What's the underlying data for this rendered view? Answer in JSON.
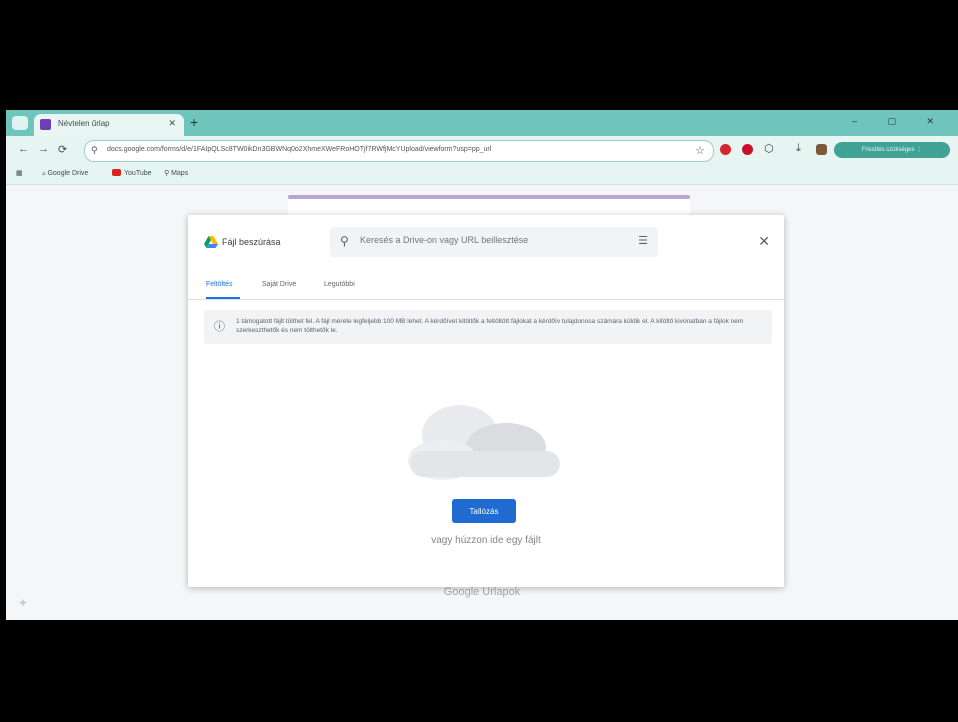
{
  "browser": {
    "tab_title": "Névtelen űrlap",
    "tab_close": "✕",
    "new_tab": "+",
    "window_controls": "– ▢ ✕",
    "nav": {
      "back": "←",
      "forward": "→",
      "reload": "⟳"
    },
    "url": "docs.google.com/forms/d/e/1FAIpQLSc8TW0ikDn3GBWNq0o2XhmeXWeFRoHOTjf7RWfjMcYUpload/viewform?usp=pp_url",
    "star": "☆",
    "profile": "Frissítés szükséges  ⋮",
    "bookmarks": {
      "apps": "▦",
      "drive": "Google Drive",
      "youtube": "YouTube",
      "maps": "Maps"
    }
  },
  "dialog": {
    "title": "Fájl beszúrása",
    "search_placeholder": "Keresés a Drive-on vagy URL beillesztése",
    "close": "✕",
    "tabs": [
      {
        "label": "Feltöltés",
        "active": true
      },
      {
        "label": "Saját Drive",
        "active": false
      },
      {
        "label": "Legutóbbi",
        "active": false
      }
    ],
    "notice": "1 támogatott fájlt tölthet fel. A fájl mérete legfeljebb 100 MB lehet. A kérdőívet kitöltők a feltöltött fájlokat a kérdőív tulajdonosa számára küldik el. A kitöltő kivonatban a fájlok nem szerkeszthetők és nem tölthetők le.",
    "browse_label": "Tallózás",
    "or_drag": "vagy húzzon ide egy fájlt"
  },
  "page": {
    "footer": "Google Űrlapok"
  },
  "colors": {
    "tabstrip": "#6fc4bb",
    "primary_button": "#1f6bd1",
    "active_tab": "#1a73e8",
    "form_accent": "#b9a4d8"
  }
}
